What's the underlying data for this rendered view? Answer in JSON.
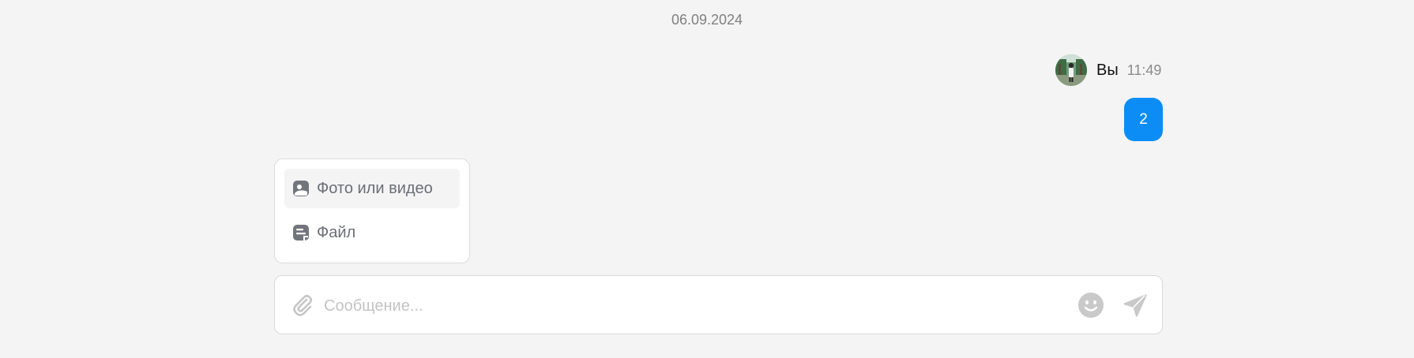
{
  "chat": {
    "date_separator": "06.09.2024",
    "messages": [
      {
        "author": "Вы",
        "time": "11:49",
        "text": "2",
        "avatar": "avatar-photo-icon"
      }
    ]
  },
  "attach_menu": {
    "items": [
      {
        "label": "Фото или видео",
        "icon": "photo-video-icon"
      },
      {
        "label": "Файл",
        "icon": "file-icon"
      }
    ]
  },
  "composer": {
    "placeholder": "Сообщение...",
    "value": "",
    "icons": {
      "attach": "paperclip-icon",
      "emoji": "emoji-icon",
      "send": "send-icon"
    }
  },
  "colors": {
    "background": "#f4f4f4",
    "bubble": "#0b8df5",
    "muted_icon": "#c8c8c8",
    "menu_text": "#6b6e75"
  }
}
